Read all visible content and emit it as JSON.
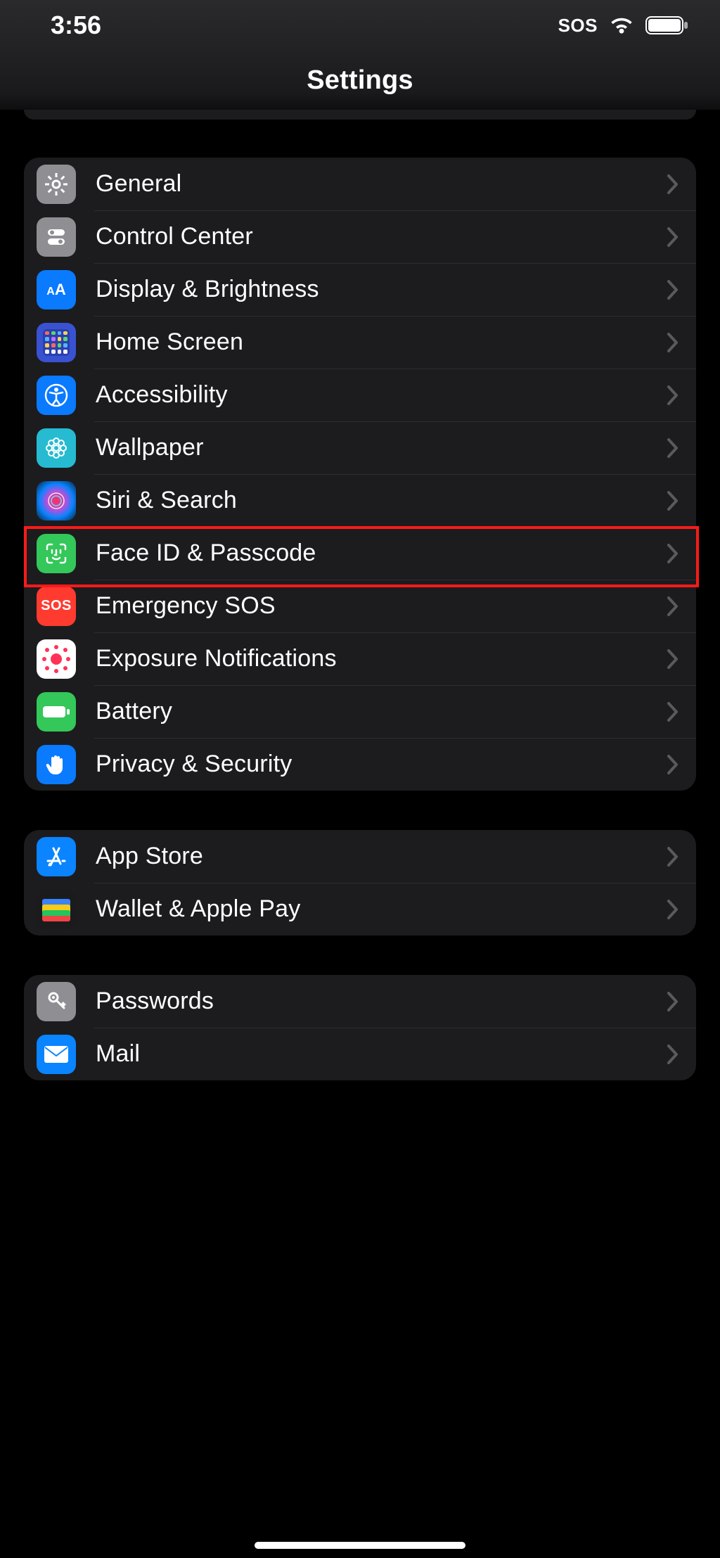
{
  "status": {
    "time": "3:56",
    "sos": "SOS"
  },
  "nav": {
    "title": "Settings"
  },
  "groups": [
    {
      "rows": [
        {
          "icon": "general",
          "label": "General"
        },
        {
          "icon": "controlcenter",
          "label": "Control Center"
        },
        {
          "icon": "display",
          "label": "Display & Brightness"
        },
        {
          "icon": "home",
          "label": "Home Screen"
        },
        {
          "icon": "accessibility",
          "label": "Accessibility"
        },
        {
          "icon": "wallpaper",
          "label": "Wallpaper"
        },
        {
          "icon": "siri",
          "label": "Siri & Search"
        },
        {
          "icon": "faceid",
          "label": "Face ID & Passcode",
          "highlighted": true
        },
        {
          "icon": "sos",
          "label": "Emergency SOS"
        },
        {
          "icon": "exposure",
          "label": "Exposure Notifications"
        },
        {
          "icon": "battery",
          "label": "Battery"
        },
        {
          "icon": "privacy",
          "label": "Privacy & Security"
        }
      ]
    },
    {
      "rows": [
        {
          "icon": "appstore",
          "label": "App Store"
        },
        {
          "icon": "wallet",
          "label": "Wallet & Apple Pay"
        }
      ]
    },
    {
      "rows": [
        {
          "icon": "passwords",
          "label": "Passwords"
        },
        {
          "icon": "mail",
          "label": "Mail"
        }
      ]
    }
  ]
}
